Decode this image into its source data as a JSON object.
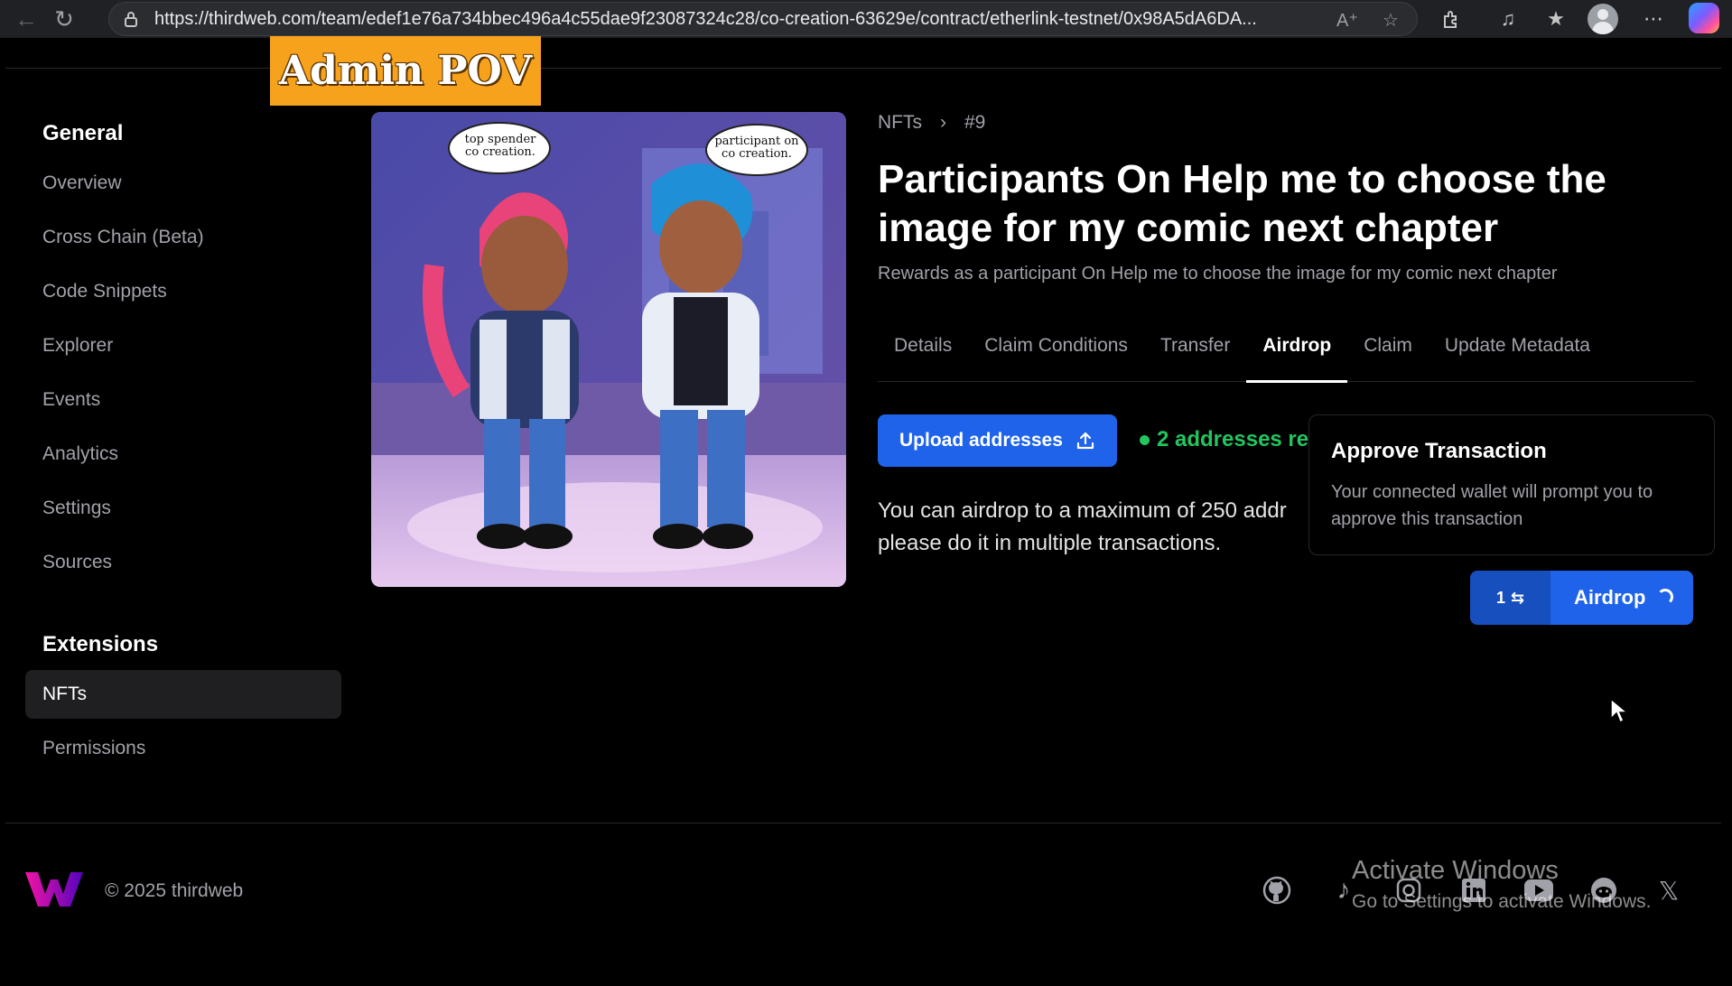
{
  "browser": {
    "url": "https://thirdweb.com/team/edef1e76a734bbec496a4c55dae9f23087324c28/co-creation-63629e/contract/etherlink-testnet/0x98A5dA6DA..."
  },
  "overlay": {
    "pov_label": "Admin POV"
  },
  "sidebar": {
    "general_heading": "General",
    "general_items": [
      {
        "label": "Overview"
      },
      {
        "label": "Cross Chain (Beta)"
      },
      {
        "label": "Code Snippets"
      },
      {
        "label": "Explorer"
      },
      {
        "label": "Events"
      },
      {
        "label": "Analytics"
      },
      {
        "label": "Settings"
      },
      {
        "label": "Sources"
      }
    ],
    "extensions_heading": "Extensions",
    "extension_items": [
      {
        "label": "NFTs",
        "active": true
      },
      {
        "label": "Permissions"
      }
    ]
  },
  "nft": {
    "bubble_left": "top spender co creation.",
    "bubble_right": "participant on co creation."
  },
  "main": {
    "breadcrumb": [
      "NFTs",
      "#9"
    ],
    "title": "Participants On Help me to choose the image for my comic next chapter",
    "subtitle": "Rewards as a participant On Help me to choose the image for my comic next chapter",
    "tabs": [
      {
        "label": "Details"
      },
      {
        "label": "Claim Conditions"
      },
      {
        "label": "Transfer"
      },
      {
        "label": "Airdrop",
        "active": true
      },
      {
        "label": "Claim"
      },
      {
        "label": "Update Metadata"
      }
    ],
    "upload_button": "Upload addresses",
    "status_text": "2 addresses re",
    "info_text_line1": "You can airdrop to a maximum of 250 addr",
    "info_text_line2": "please do it in multiple transactions.",
    "popover_title": "Approve Transaction",
    "popover_body": "Your connected wallet will prompt you to approve this transaction",
    "tx_count": "1",
    "airdrop_button": "Airdrop"
  },
  "footer": {
    "copyright": "© 2025 thirdweb",
    "social_icons": [
      "github-icon",
      "tiktok-icon",
      "instagram-icon",
      "linkedin-icon",
      "youtube-icon",
      "reddit-icon",
      "x-icon"
    ]
  },
  "watermark": {
    "line1": "Activate Windows",
    "line2": "Go to Settings to activate Windows."
  },
  "colors": {
    "primary": "#1e63e9",
    "success": "#22c55e",
    "pov_badge": "#f6a21c"
  }
}
